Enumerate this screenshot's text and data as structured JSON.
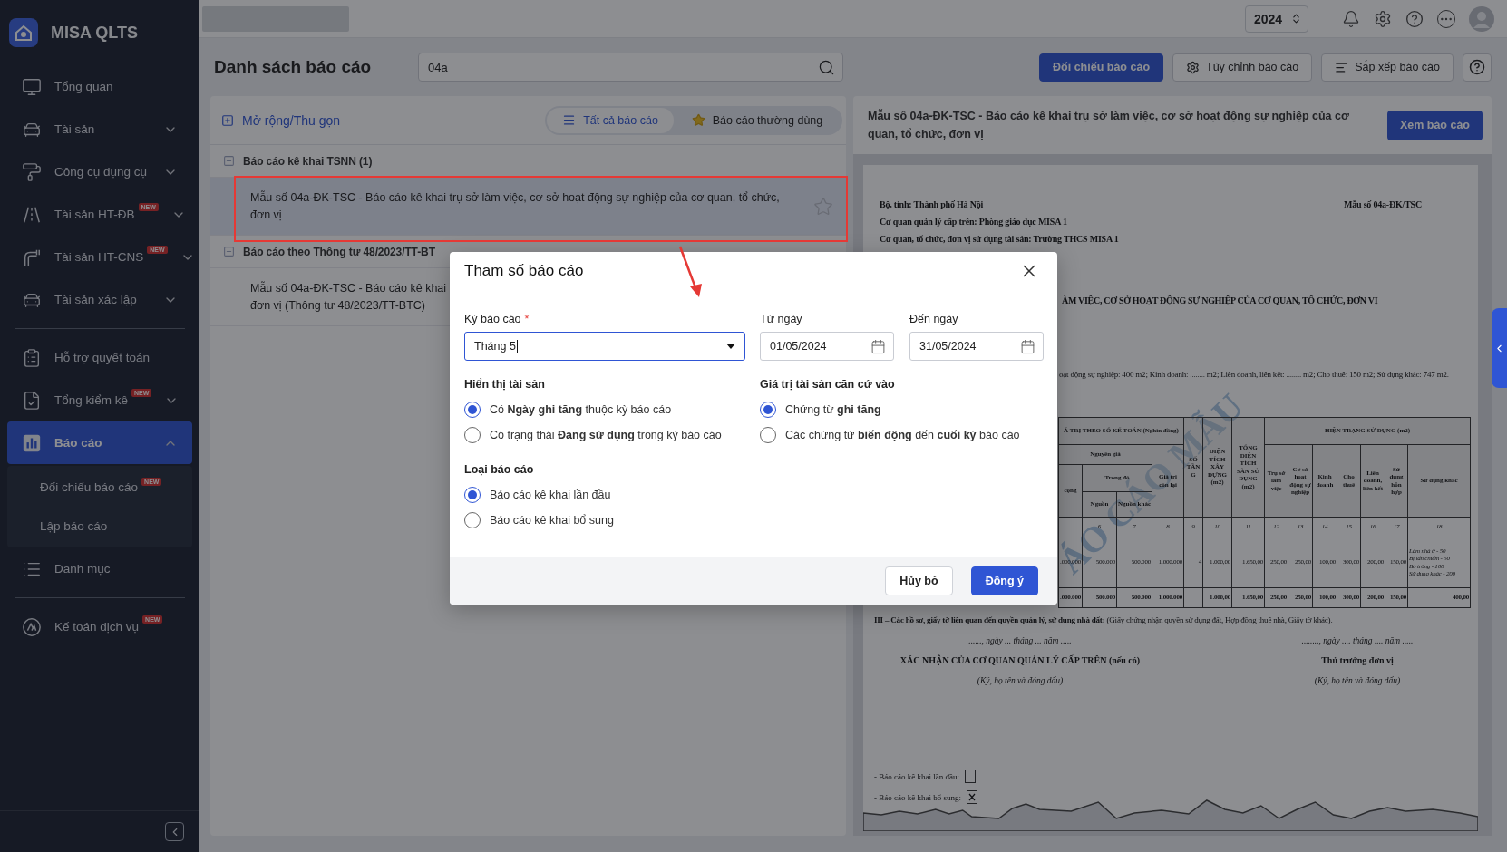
{
  "sidebar": {
    "logo_text": "MISA QLTS",
    "items": [
      {
        "label": "Tổng quan",
        "selected": false
      },
      {
        "label": "Tài sản",
        "selected": false,
        "expanded": false
      },
      {
        "label": "Công cụ dụng cụ",
        "selected": false,
        "expanded": false
      },
      {
        "label": "Tài sản HT-ĐB",
        "badge": "NEW",
        "selected": false,
        "expanded": false
      },
      {
        "label": "Tài sản HT-CNS",
        "badge": "NEW",
        "selected": false,
        "expanded": false
      },
      {
        "label": "Tài sản xác lập",
        "selected": false,
        "expanded": false
      },
      {
        "label": "Hỗ trợ quyết toán",
        "selected": false,
        "divider_before": true
      },
      {
        "label": "Tổng kiểm kê",
        "badge": "NEW",
        "selected": false,
        "expanded": false
      },
      {
        "label": "Báo cáo",
        "selected": true,
        "expanded": true,
        "children": [
          {
            "label": "Đối chiếu báo cáo",
            "badge": "NEW",
            "selected": false
          },
          {
            "label": "Lập báo cáo",
            "selected": false
          }
        ]
      },
      {
        "label": "Danh mục",
        "selected": false
      },
      {
        "label": "Kế toán dịch vụ",
        "badge": "NEW",
        "selected": false,
        "divider_before": true
      }
    ]
  },
  "topbar": {
    "year": "2024"
  },
  "header": {
    "title": "Danh sách báo cáo",
    "search": {
      "value": "04a"
    },
    "buttons": [
      {
        "label": "Đối chiếu báo cáo",
        "kind": "primary"
      },
      {
        "label": "Tùy chỉnh báo cáo",
        "kind": "settings"
      },
      {
        "label": "Sắp xếp báo cáo",
        "kind": "sort"
      },
      {
        "kind": "help"
      }
    ]
  },
  "report_list": {
    "toggle_label": "Mở rộng/Thu gọn",
    "filters": [
      {
        "label": "Tất cả báo cáo",
        "selected": true
      },
      {
        "label": "Báo cáo thường dùng",
        "selected": false
      }
    ],
    "groups": [
      {
        "title": "Báo cáo kê khai TSNN (1)",
        "expanded": true,
        "items": [
          {
            "lines": [
              "Mẫu số 04a-ĐK-TSC - Báo cáo kê khai trụ sở làm việc, cơ sở hoạt động sự nghiệp của cơ quan, tổ chức,",
              "đơn vị"
            ],
            "selected": true,
            "favorite": false
          }
        ]
      },
      {
        "title": "Báo cáo theo Thông tư 48/2023/TT-BT",
        "expanded": true,
        "items": [
          {
            "lines": [
              "Mẫu số 04a-ĐK-TSC - Báo cáo kê khai",
              "đơn vị (Thông tư 48/2023/TT-BTC)"
            ],
            "selected": false
          }
        ]
      }
    ]
  },
  "preview": {
    "title": "Mẫu số 04a-ĐK-TSC - Báo cáo kê khai trụ sở làm việc, cơ sở hoạt động sự nghiệp của cơ quan, tổ chức, đơn vị",
    "view_button": "Xem báo cáo",
    "document": {
      "header_left": [
        "Bộ, tỉnh: Thành phố Hà Nội",
        "Cơ quan quản lý cấp trên: Phòng giáo dục MISA 1",
        "Cơ quan, tổ chức, đơn vị sử dụng tài sản: Trường THCS MISA 1"
      ],
      "form_code": "Mẫu số 04a-ĐK/TSC",
      "title_fragment": "ÀM VIỆC, CƠ SỞ HOẠT ĐỘNG SỰ NGHIỆP CỦA CƠ QUAN, TỔ CHỨC, ĐƠN VỊ",
      "area_fragment": "oạt động sự nghiệp: 400 m2; Kinh doanh: ........ m2; Liên doanh, liên kết: ........ m2; Cho thuê: 150 m2; Sử dụng khác: 747 m2.",
      "watermark": "ÁO CÁO MẪU",
      "table": {
        "value_group": "Á TRỊ THEO SỔ KẾ TOÁN (Nghìn đồng)",
        "original_cost": "Nguyên giá",
        "total": "cộng",
        "of_which": "Trong đó",
        "source": "Nguồn",
        "other_source": "Nguồn khác",
        "residual": "Giá trị còn lại",
        "floors": "SỐ TẦNG",
        "built_area": "DIỆN TÍCH XÂY DỰNG (m2)",
        "floor_area": "TỔNG DIỆN TÍCH SÀN SỬ DỤNG (m2)",
        "usage_group": "HIỆN TRẠNG SỬ DỤNG (m2)",
        "usage_columns": [
          "Trụ sở làm việc",
          "Cơ sở hoạt động sự nghiệp",
          "Kinh doanh",
          "Cho thuê",
          "Liên doanh, liên kết",
          "Sử dụng hỗn hợp",
          "Sử dụng khác"
        ],
        "column_numbers": [
          "6",
          "7",
          "8",
          "9",
          "10",
          "11",
          "12",
          "13",
          "14",
          "15",
          "16",
          "17",
          "18"
        ],
        "rows": [
          {
            "total": false,
            "cells": [
              ".000.000",
              "500.000",
              "500.000",
              "1.000.000",
              "4",
              "1.000,00",
              "1.650,00",
              "250,00",
              "250,00",
              "100,00",
              "300,00",
              "200,00",
              "150,00",
              [
                "Làm nhà ở - 50",
                "Bị lấn chiếm - 50",
                "Bỏ trống - 100",
                "Sử dụng khác - 200"
              ]
            ]
          },
          {
            "total": true,
            "cells": [
              ".000.000",
              "500.000",
              "500.000",
              "1.000.000",
              null,
              "1.000,00",
              "1.650,00",
              "250,00",
              "250,00",
              "100,00",
              "300,00",
              "200,00",
              "150,00",
              "400,00"
            ]
          }
        ]
      },
      "section_iii": "**III – Các hồ sơ, giấy tờ liên quan đến quyền quản lý, sử dụng nhà đất:** (Giấy chứng nhận quyền sử dụng đất, Hợp đồng thuê nhà, Giấy tờ khác).",
      "signatures": [
        {
          "date": "......, ngày ... tháng ... năm .....",
          "title": "XÁC NHẬN CỦA CƠ QUAN QUẢN LÝ CẤP TRÊN (nếu có)",
          "note": "(Ký, họ tên và đóng dấu)"
        },
        {
          "date": "........, ngày .... tháng .... năm .....",
          "title": "Thủ trưởng đơn vị",
          "note": "(Ký, họ tên và đóng dấu)"
        }
      ],
      "report_types": [
        {
          "label": "- Báo cáo kê khai lần đầu:",
          "checked": false
        },
        {
          "label": "- Báo cáo kê khai bổ sung:",
          "checked": true
        }
      ]
    }
  },
  "dialog": {
    "title": "Tham số báo cáo",
    "period": {
      "label": "Kỳ báo cáo",
      "required": true,
      "required_mark": "*",
      "value": "Tháng 5",
      "focused": true
    },
    "from_date": {
      "label": "Từ ngày",
      "value": "01/05/2024"
    },
    "to_date": {
      "label": "Đến ngày",
      "value": "31/05/2024"
    },
    "groups": [
      {
        "title": "Hiển thị tài sản",
        "options": [
          {
            "label": "Có **Ngày ghi tăng** thuộc kỳ báo cáo",
            "selected": true
          },
          {
            "label": "Có trạng thái **Đang sử dụng** trong kỳ báo cáo",
            "selected": false
          }
        ]
      },
      {
        "title": "Giá trị tài sản căn cứ vào",
        "options": [
          {
            "label": "Chứng từ **ghi tăng**",
            "selected": true
          },
          {
            "label": "Các chứng từ **biến động** đến **cuối kỳ** báo cáo",
            "selected": false
          }
        ]
      },
      {
        "title": "Loại báo cáo",
        "options": [
          {
            "label": "Báo cáo kê khai lần đầu",
            "selected": true
          },
          {
            "label": "Báo cáo kê khai bổ sung",
            "selected": false
          }
        ]
      }
    ],
    "buttons": [
      {
        "label": "Hủy bỏ",
        "kind": "secondary"
      },
      {
        "label": "Đồng ý",
        "kind": "primary"
      }
    ]
  }
}
